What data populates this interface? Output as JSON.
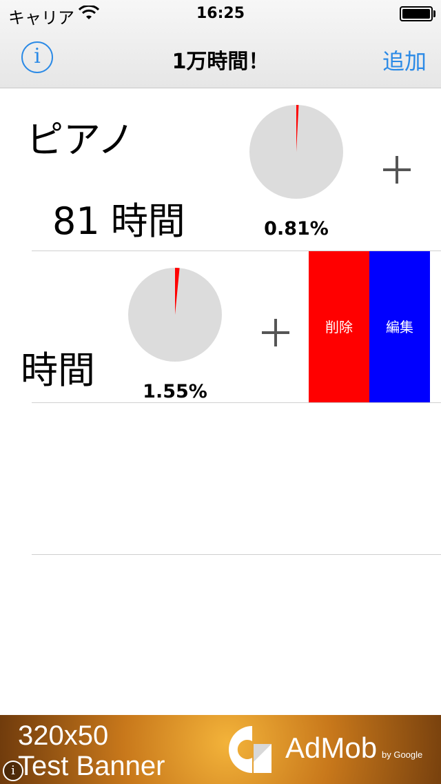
{
  "status_bar": {
    "carrier": "キャリア",
    "time": "16:25",
    "wifi_icon": "wifi-icon",
    "battery_icon": "battery-icon"
  },
  "nav": {
    "info_icon": "i",
    "title": "1万時間！",
    "add_label": "追加"
  },
  "activities": [
    {
      "name": "ピアノ",
      "hours_value": "81",
      "hours_unit": "時間",
      "percent": "0.81%",
      "progress": 0.0081,
      "plus_icon": "plus-icon"
    },
    {
      "name": "",
      "hours_value": "",
      "hours_unit": "時間",
      "percent": "1.55%",
      "progress": 0.0155,
      "plus_icon": "plus-icon",
      "swipe_actions": {
        "delete_label": "削除",
        "edit_label": "編集"
      }
    }
  ],
  "colors": {
    "accent": "#2b8ae6",
    "pie_background": "#dcdcdc",
    "pie_progress": "#ff0000",
    "delete": "#ff0000",
    "edit": "#0000ff"
  },
  "ad_banner": {
    "size_label": "320x50",
    "label": "Test Banner",
    "brand": "AdMob",
    "brand_byline": "by Google",
    "info_icon": "i"
  }
}
